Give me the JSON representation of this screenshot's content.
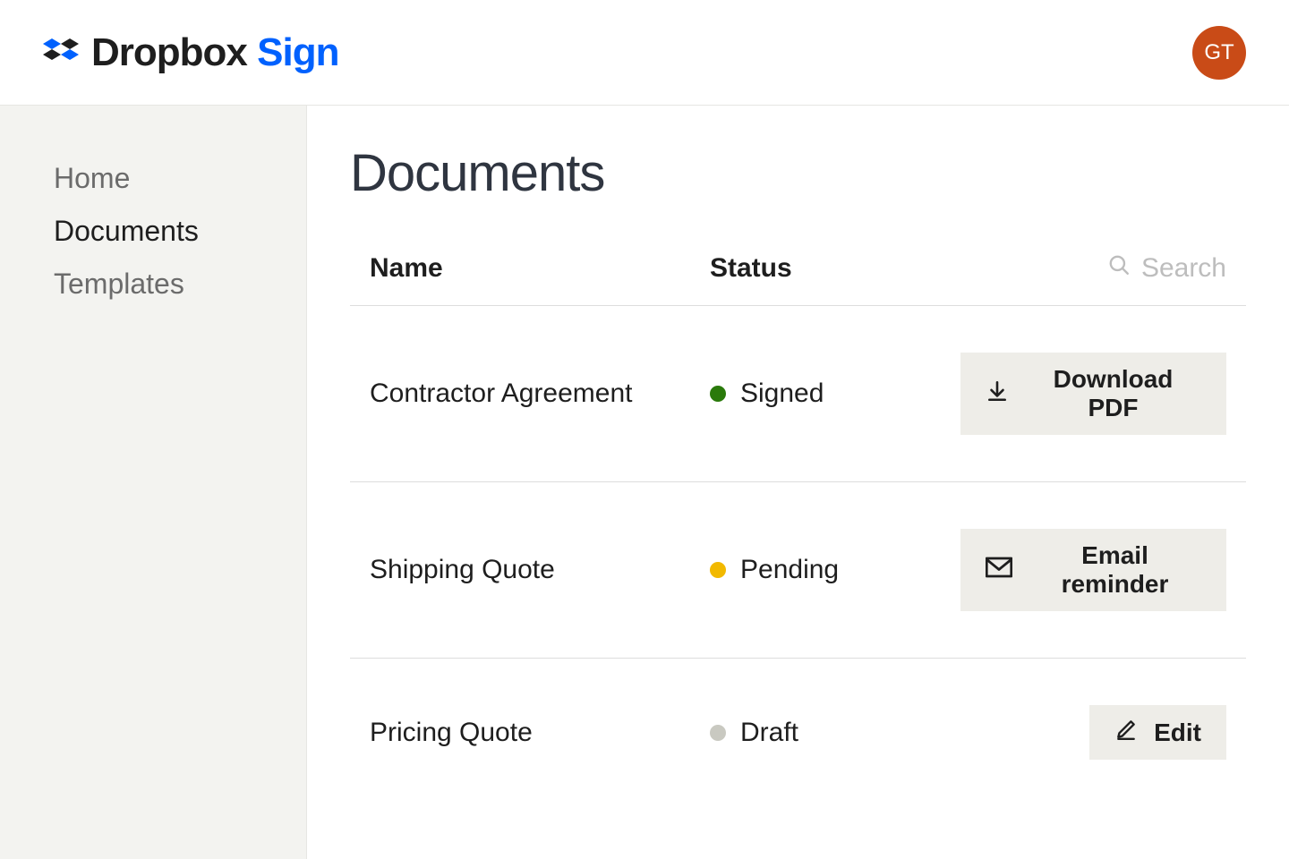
{
  "header": {
    "brand_primary": "Dropbox",
    "brand_secondary": "Sign",
    "avatar_initials": "GT"
  },
  "sidebar": {
    "items": [
      {
        "label": "Home",
        "active": false
      },
      {
        "label": "Documents",
        "active": true
      },
      {
        "label": "Templates",
        "active": false
      }
    ]
  },
  "main": {
    "title": "Documents",
    "columns": {
      "name": "Name",
      "status": "Status"
    },
    "search_placeholder": "Search",
    "rows": [
      {
        "name": "Contractor Agreement",
        "status_label": "Signed",
        "status_kind": "signed",
        "action_label": "Download PDF",
        "action_icon": "download"
      },
      {
        "name": "Shipping Quote",
        "status_label": "Pending",
        "status_kind": "pending",
        "action_label": "Email reminder",
        "action_icon": "mail"
      },
      {
        "name": "Pricing Quote",
        "status_label": "Draft",
        "status_kind": "draft",
        "action_label": "Edit",
        "action_icon": "edit"
      }
    ]
  },
  "colors": {
    "accent_blue": "#0061fe",
    "avatar_bg": "#c94b17",
    "status_signed": "#2a7a0b",
    "status_pending": "#f2b900",
    "status_draft": "#c9c9c1"
  }
}
